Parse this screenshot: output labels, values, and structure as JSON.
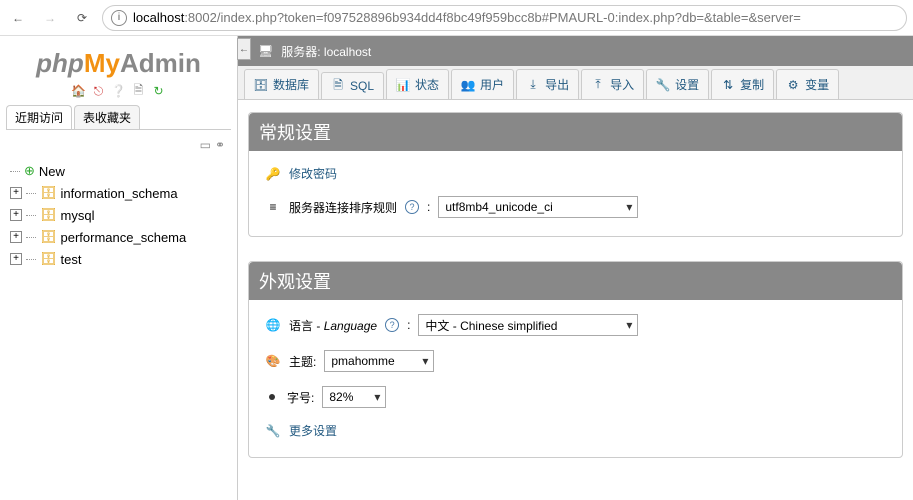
{
  "browser": {
    "url_host": "localhost",
    "url_rest": ":8002/index.php?token=f097528896b934dd4f8bc49f959bcc8b#PMAURL-0:index.php?db=&table=&server="
  },
  "sidebar": {
    "logo_php": "php",
    "logo_my": "My",
    "logo_admin": "Admin",
    "nav_recent": "近期访问",
    "nav_fav": "表收藏夹",
    "tree": {
      "new": "New",
      "items": [
        "information_schema",
        "mysql",
        "performance_schema",
        "test"
      ]
    }
  },
  "server_bar": {
    "label": "服务器: localhost"
  },
  "tabs": [
    {
      "label": "数据库"
    },
    {
      "label": "SQL"
    },
    {
      "label": "状态"
    },
    {
      "label": "用户"
    },
    {
      "label": "导出"
    },
    {
      "label": "导入"
    },
    {
      "label": "设置"
    },
    {
      "label": "复制"
    },
    {
      "label": "变量"
    }
  ],
  "panel1": {
    "title": "常规设置",
    "change_pw": "修改密码",
    "collation_label": "服务器连接排序规则",
    "collation_value": "utf8mb4_unicode_ci"
  },
  "panel2": {
    "title": "外观设置",
    "lang_label": "语言",
    "lang_label_it": "Language",
    "lang_value": "中文 - Chinese simplified",
    "theme_label": "主题:",
    "theme_value": "pmahomme",
    "font_label": "字号:",
    "font_value": "82%",
    "more": "更多设置"
  }
}
